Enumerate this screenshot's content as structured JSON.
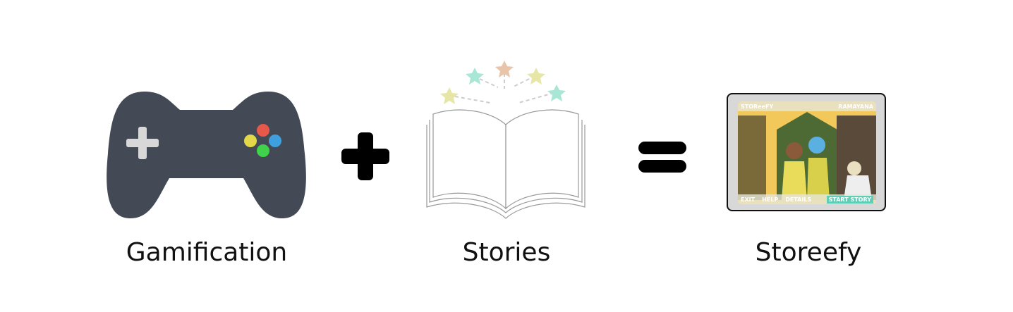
{
  "labels": {
    "left": "Gamification",
    "middle": "Stories",
    "right": "Storeefy"
  },
  "operators": {
    "plus": "+",
    "equals": "="
  },
  "tablet": {
    "brand": "STOReeFY",
    "title": "RAMAYANA",
    "buttons": [
      "EXIT",
      "HELP",
      "DETAILS",
      "START STORY"
    ]
  },
  "colors": {
    "controller": "#434a56",
    "accent": "#5ecfb6"
  }
}
